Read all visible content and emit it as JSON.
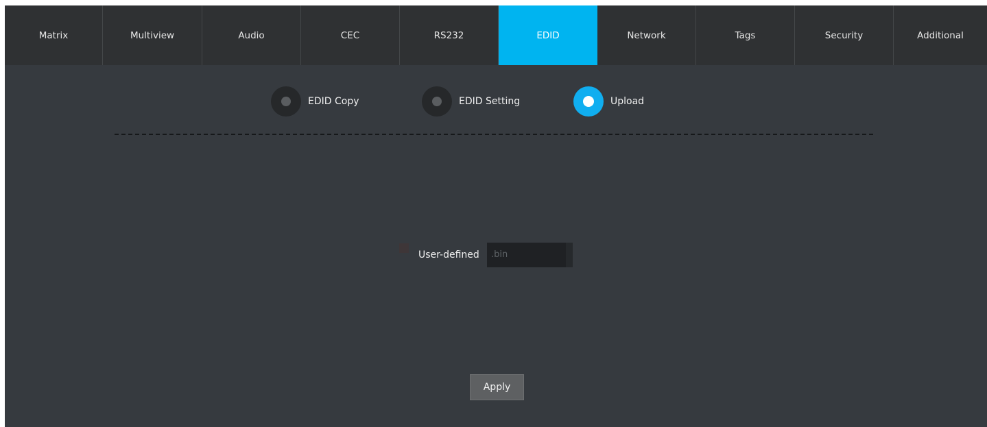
{
  "tabs": [
    {
      "label": "Matrix",
      "width": 143,
      "active": false
    },
    {
      "label": "Multiview",
      "width": 145,
      "active": false
    },
    {
      "label": "Audio",
      "width": 144,
      "active": false
    },
    {
      "label": "CEC",
      "width": 144,
      "active": false
    },
    {
      "label": "RS232",
      "width": 144,
      "active": false
    },
    {
      "label": "EDID",
      "width": 144,
      "active": true
    },
    {
      "label": "Network",
      "width": 144,
      "active": false
    },
    {
      "label": "Tags",
      "width": 144,
      "active": false
    },
    {
      "label": "Security",
      "width": 144,
      "active": false
    },
    {
      "label": "Additional",
      "width": 136,
      "active": false
    }
  ],
  "edid_modes": [
    {
      "label": "EDID Copy",
      "selected": false
    },
    {
      "label": "EDID Setting",
      "selected": false
    },
    {
      "label": "Upload",
      "selected": true
    }
  ],
  "upload": {
    "user_defined_label": "User-defined",
    "user_defined_checked": false,
    "file_placeholder": ".bin"
  },
  "apply_label": "Apply",
  "colors": {
    "accent": "#00b4f0",
    "background": "#363a3f",
    "tabbar": "#2f3133"
  }
}
